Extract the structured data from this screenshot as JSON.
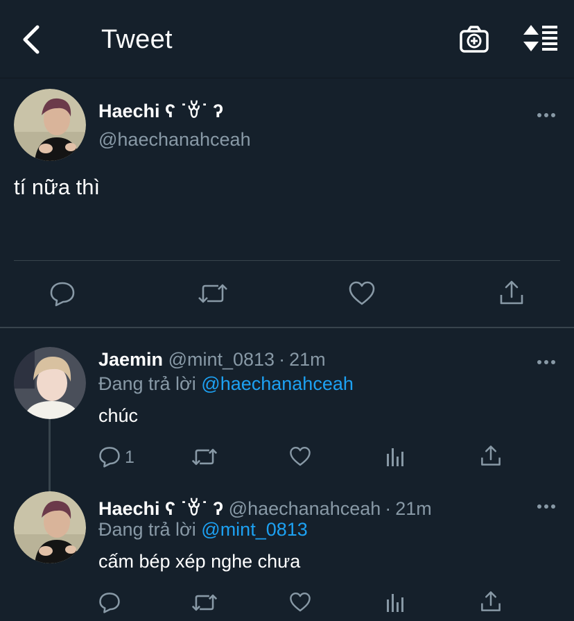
{
  "header": {
    "title": "Tweet"
  },
  "main_tweet": {
    "name": "Haechi ʕ ˙ꈊ˙ ʔ",
    "handle": "@haechanahceah",
    "text": "tí nữa thì"
  },
  "replies": [
    {
      "name": "Jaemin",
      "handle": "@mint_0813",
      "time": "21m",
      "replying_prefix": "Đang trả lời",
      "replying_to": "@haechanahceah",
      "text": "chúc",
      "reply_count": "1"
    },
    {
      "name": "Haechi ʕ ˙ꈊ˙ ʔ",
      "handle": "@haechanahceah",
      "time": "21m",
      "replying_prefix": "Đang trả lời",
      "replying_to": "@mint_0813",
      "text": "cấm bép xép nghe chưa"
    }
  ],
  "colors": {
    "background": "#15202b",
    "secondary_text": "#8899a6",
    "link": "#1da1f2",
    "divider": "#38444d"
  },
  "icons": [
    "back-arrow-icon",
    "camera-plus-icon",
    "sort-lines-icon",
    "more-dots-icon",
    "reply-icon",
    "retweet-icon",
    "like-icon",
    "share-icon",
    "analytics-icon"
  ]
}
